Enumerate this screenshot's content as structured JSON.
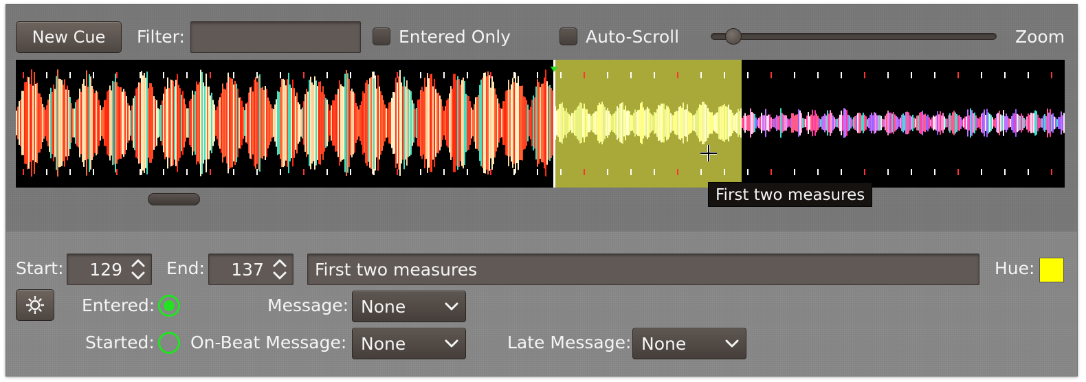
{
  "toolbar": {
    "new_cue_label": "New Cue",
    "filter_label": "Filter:",
    "filter_value": "",
    "entered_only_label": "Entered Only",
    "auto_scroll_label": "Auto-Scroll",
    "zoom_label": "Zoom",
    "zoom_level": 0.05
  },
  "waveform": {
    "tooltip": "First two measures",
    "playhead_color": "#ffffff",
    "cue_color": "#a9a93a"
  },
  "cue_editor": {
    "start_label": "Start:",
    "start_value": "129",
    "end_label": "End:",
    "end_value": "137",
    "comment_value": "First two measures",
    "hue_label": "Hue:",
    "hue_color": "#ffff00",
    "entered_label": "Entered:",
    "entered_state": true,
    "started_label": "Started:",
    "started_state": false,
    "message_label": "Message:",
    "message_value": "None",
    "onbeat_label": "On-Beat Message:",
    "onbeat_value": "None",
    "late_label": "Late Message:",
    "late_value": "None",
    "indicator_color": "#22e222"
  },
  "icons": {
    "gear": "gear-icon",
    "chevron": "chevron-down-icon",
    "spinner": "spinner-arrows-icon",
    "cursor": "crosshair-cursor-icon"
  }
}
